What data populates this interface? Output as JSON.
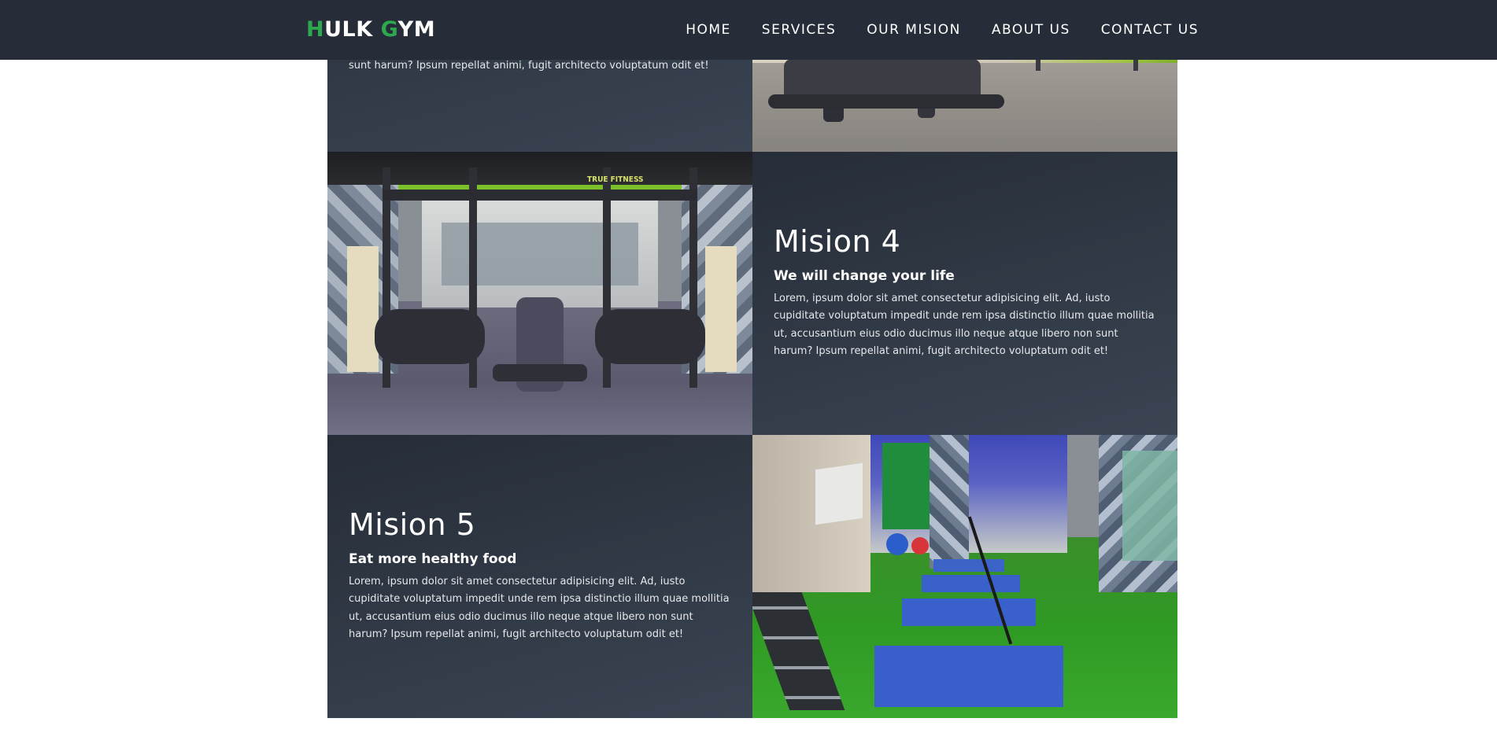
{
  "navbar": {
    "logo": {
      "h": "H",
      "ulk": "ULK ",
      "g": "G",
      "ym": "YM"
    },
    "links": [
      {
        "label": "HOME"
      },
      {
        "label": "SERVICES"
      },
      {
        "label": "OUR MISION"
      },
      {
        "label": "ABOUT US"
      },
      {
        "label": "CONTACT US"
      }
    ]
  },
  "colors": {
    "navbar_bg": "#262d38",
    "logo_accent": "#2ea84f",
    "card_bg": "#2f3743",
    "text": "#ffffff"
  },
  "missions": {
    "m3": {
      "text_tail": "sunt harum? Ipsum repellat animi, fugit architecto voluptatum odit et!"
    },
    "m4": {
      "title": "Mision 4",
      "subtitle": "We will change your life",
      "text": "Lorem, ipsum dolor sit amet consectetur adipisicing elit. Ad, iusto cupiditate voluptatum impedit unde rem ipsa distinctio illum quae mollitia ut, accusantium eius odio ducimus illo neque atque libero non sunt harum? Ipsum repellat animi, fugit architecto voluptatum odit et!"
    },
    "m5": {
      "title": "Mision 5",
      "subtitle": "Eat more healthy food",
      "text": "Lorem, ipsum dolor sit amet consectetur adipisicing elit. Ad, iusto cupiditate voluptatum impedit unde rem ipsa distinctio illum quae mollitia ut, accusantium eius odio ducimus illo neque atque libero non sunt harum? Ipsum repellat animi, fugit architecto voluptatum odit et!"
    }
  },
  "photos": {
    "gym_sign": "TRUE FITNESS"
  }
}
